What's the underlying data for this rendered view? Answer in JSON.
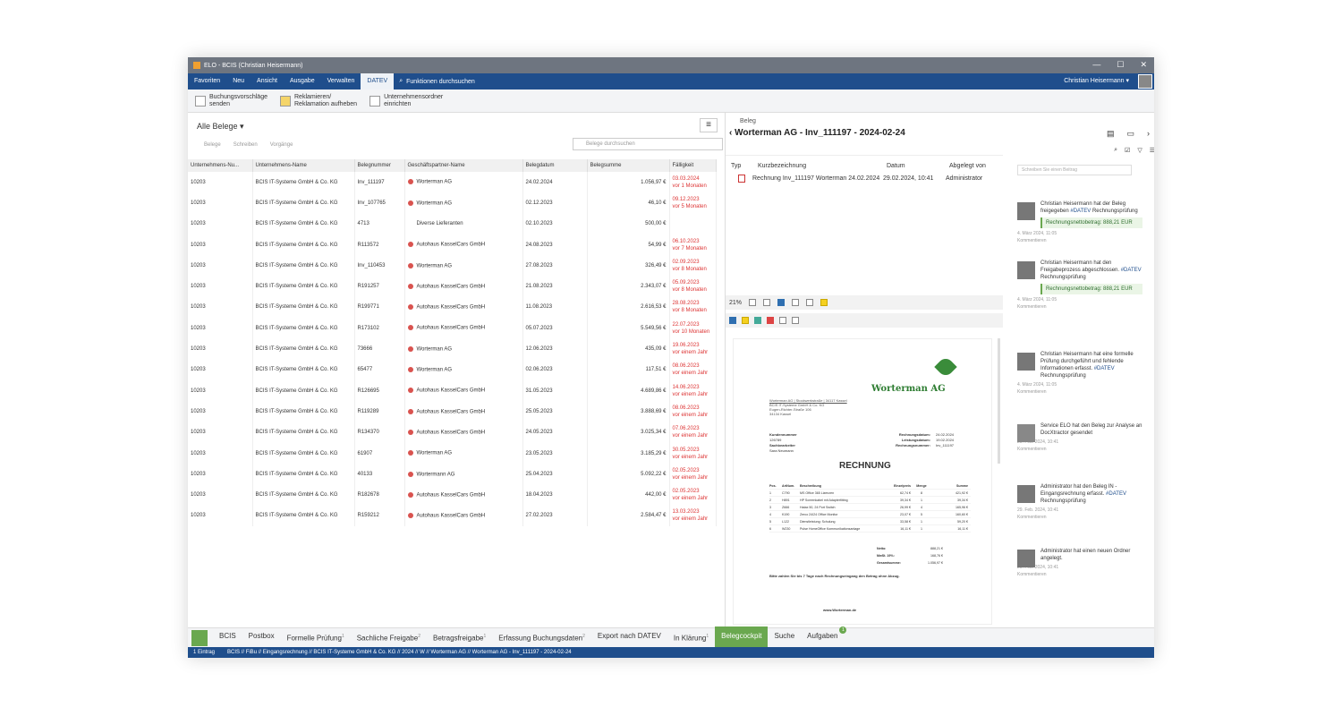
{
  "window": {
    "title": "ELO - BCIS (Christian Heisermann)",
    "controls": [
      "—",
      "☐",
      "✕"
    ]
  },
  "menu": {
    "items": [
      "Favoriten",
      "Neu",
      "Ansicht",
      "Ausgabe",
      "Verwalten",
      "DATEV"
    ],
    "active": "DATEV",
    "search": "Funktionen durchsuchen",
    "user": "Christian Heisermann"
  },
  "ribbon": [
    {
      "line1": "Buchungsvorschläge",
      "line2": "senden"
    },
    {
      "line1": "Reklamieren/",
      "line2": "Reklamation aufheben"
    },
    {
      "line1": "Unternehmensordner",
      "line2": "einrichten"
    }
  ],
  "list": {
    "title": "Alle Belege",
    "filters": [
      "Belege",
      "Schreiben",
      "Vorgänge"
    ],
    "search_placeholder": "Belege durchsuchen",
    "columns": [
      "Unternehmens-Nu...",
      "Unternehmens-Name",
      "Belegnummer",
      "Geschäftspartner-Name",
      "Belegdatum",
      "Belegsumme",
      "Fälligkeit"
    ],
    "rows": [
      {
        "nr": "10203",
        "name": "BCIS IT-Systeme GmbH & Co. KG",
        "beleg": "Inv_111197",
        "dot": true,
        "partner": "Worterman AG",
        "datum": "24.02.2024",
        "summe": "1.056,97 €",
        "due1": "03.03.2024",
        "due2": "vor 1 Monaten"
      },
      {
        "nr": "10203",
        "name": "BCIS IT-Systeme GmbH & Co. KG",
        "beleg": "Inv_107765",
        "dot": true,
        "partner": "Worterman AG",
        "datum": "02.12.2023",
        "summe": "46,10 €",
        "due1": "09.12.2023",
        "due2": "vor 5 Monaten"
      },
      {
        "nr": "10203",
        "name": "BCIS IT-Systeme GmbH & Co. KG",
        "beleg": "4713",
        "dot": false,
        "partner": "Diverse Lieferanten",
        "datum": "02.10.2023",
        "summe": "500,00 €",
        "due1": "",
        "due2": ""
      },
      {
        "nr": "10203",
        "name": "BCIS IT-Systeme GmbH & Co. KG",
        "beleg": "R113572",
        "dot": true,
        "partner": "Autohaus KasselCars GmbH",
        "datum": "24.08.2023",
        "summe": "54,99 €",
        "due1": "06.10.2023",
        "due2": "vor 7 Monaten"
      },
      {
        "nr": "10203",
        "name": "BCIS IT-Systeme GmbH & Co. KG",
        "beleg": "Inv_110453",
        "dot": true,
        "partner": "Worterman AG",
        "datum": "27.08.2023",
        "summe": "326,49 €",
        "due1": "02.09.2023",
        "due2": "vor 8 Monaten"
      },
      {
        "nr": "10203",
        "name": "BCIS IT-Systeme GmbH & Co. KG",
        "beleg": "R191257",
        "dot": true,
        "partner": "Autohaus KasselCars GmbH",
        "datum": "21.08.2023",
        "summe": "2.343,07 €",
        "due1": "05.09.2023",
        "due2": "vor 8 Monaten"
      },
      {
        "nr": "10203",
        "name": "BCIS IT-Systeme GmbH & Co. KG",
        "beleg": "R199771",
        "dot": true,
        "partner": "Autohaus KasselCars GmbH",
        "datum": "11.08.2023",
        "summe": "2.616,53 €",
        "due1": "28.08.2023",
        "due2": "vor 8 Monaten"
      },
      {
        "nr": "10203",
        "name": "BCIS IT-Systeme GmbH & Co. KG",
        "beleg": "R173102",
        "dot": true,
        "partner": "Autohaus KasselCars GmbH",
        "datum": "05.07.2023",
        "summe": "5.549,56 €",
        "due1": "22.07.2023",
        "due2": "vor 10 Monaten"
      },
      {
        "nr": "10203",
        "name": "BCIS IT-Systeme GmbH & Co. KG",
        "beleg": "73666",
        "dot": true,
        "partner": "Worterman AG",
        "datum": "12.06.2023",
        "summe": "435,09 €",
        "due1": "19.06.2023",
        "due2": "vor einem Jahr"
      },
      {
        "nr": "10203",
        "name": "BCIS IT-Systeme GmbH & Co. KG",
        "beleg": "65477",
        "dot": true,
        "partner": "Worterman AG",
        "datum": "02.06.2023",
        "summe": "117,51 €",
        "due1": "08.06.2023",
        "due2": "vor einem Jahr"
      },
      {
        "nr": "10203",
        "name": "BCIS IT-Systeme GmbH & Co. KG",
        "beleg": "R126695",
        "dot": true,
        "partner": "Autohaus KasselCars GmbH",
        "datum": "31.05.2023",
        "summe": "4.689,86 €",
        "due1": "14.06.2023",
        "due2": "vor einem Jahr"
      },
      {
        "nr": "10203",
        "name": "BCIS IT-Systeme GmbH & Co. KG",
        "beleg": "R119289",
        "dot": true,
        "partner": "Autohaus KasselCars GmbH",
        "datum": "25.05.2023",
        "summe": "3.888,69 €",
        "due1": "08.06.2023",
        "due2": "vor einem Jahr"
      },
      {
        "nr": "10203",
        "name": "BCIS IT-Systeme GmbH & Co. KG",
        "beleg": "R134370",
        "dot": true,
        "partner": "Autohaus KasselCars GmbH",
        "datum": "24.05.2023",
        "summe": "3.025,34 €",
        "due1": "07.06.2023",
        "due2": "vor einem Jahr"
      },
      {
        "nr": "10203",
        "name": "BCIS IT-Systeme GmbH & Co. KG",
        "beleg": "61907",
        "dot": true,
        "partner": "Worterman AG",
        "datum": "23.05.2023",
        "summe": "3.185,29 €",
        "due1": "30.05.2023",
        "due2": "vor einem Jahr"
      },
      {
        "nr": "10203",
        "name": "BCIS IT-Systeme GmbH & Co. KG",
        "beleg": "40133",
        "dot": true,
        "partner": "Wortermann AG",
        "datum": "25.04.2023",
        "summe": "5.092,22 €",
        "due1": "02.05.2023",
        "due2": "vor einem Jahr"
      },
      {
        "nr": "10203",
        "name": "BCIS IT-Systeme GmbH & Co. KG",
        "beleg": "R182678",
        "dot": true,
        "partner": "Autohaus KasselCars GmbH",
        "datum": "18.04.2023",
        "summe": "442,00 €",
        "due1": "02.05.2023",
        "due2": "vor einem Jahr"
      },
      {
        "nr": "10203",
        "name": "BCIS IT-Systeme GmbH & Co. KG",
        "beleg": "R159212",
        "dot": true,
        "partner": "Autohaus KasselCars GmbH",
        "datum": "27.02.2023",
        "summe": "2.584,47 €",
        "due1": "13.03.2023",
        "due2": "vor einem Jahr"
      }
    ]
  },
  "detail": {
    "label": "Beleg",
    "title": "Worterman AG - Inv_111197 - 2024-02-24",
    "headers": [
      "Typ",
      "Kurzbezeichnung",
      "Datum",
      "Abgelegt von"
    ],
    "row": {
      "kurz": "Rechnung Inv_111197 Worterman 24.02.2024",
      "datum": "29.02.2024, 10:41",
      "von": "Administrator"
    },
    "zoom": "21%"
  },
  "invoice": {
    "company": "Worterman AG",
    "sender": [
      "Worterman AG | Stockwerkstraße | 34117 Kassel",
      "BCIS IT-Systeme GmbH & Co. KG",
      "Eugen-Richter-Straße 106",
      "34134 Kassel"
    ],
    "meta_left": [
      "Kundennummer",
      "126789",
      "Sachbearbeiter",
      "Sara Neumann"
    ],
    "meta_right_labels": [
      "Rechnungsdatum:",
      "Leistungsdatum:",
      "Rechnungsnummer:"
    ],
    "meta_right_values": [
      "24.02.2024",
      "19.02.2024",
      "Inv_111197"
    ],
    "heading": "RECHNUNG",
    "item_headers": [
      "Pos.",
      "ArtNum.",
      "Beschreibung",
      "Einzelpreis",
      "Menge",
      "Summe"
    ],
    "items": [
      [
        "1",
        "C790",
        "MS Office 365 Lizenzen",
        "62,74 €",
        "8",
        "421,92 €"
      ],
      [
        "2",
        "H891",
        "HP Screenkabel mit Adapterfitting",
        "39,34 €",
        "1",
        "39,34 €"
      ],
      [
        "3",
        "Z666",
        "Hatax 50, 24 Port Switch",
        "26,99 €",
        "4",
        "165,96 €"
      ],
      [
        "4",
        "K190",
        "Zerco 24/24 Office Monitor",
        "23,07 €",
        "5",
        "160,60 €"
      ],
      [
        "5",
        "L122",
        "Dienstleistung: Schulung",
        "33,58 €",
        "1",
        "59,20 €"
      ],
      [
        "6",
        "W230",
        "Pulse HomeOffice Kommunikationsanlage",
        "16,11 €",
        "1",
        "16,11 €"
      ]
    ],
    "totals": [
      [
        "Netto:",
        "888,21 €"
      ],
      [
        "MwSt. 19%:",
        "168,76 €"
      ],
      [
        "Gesamtsumme:",
        "1.056,97 €"
      ]
    ],
    "note": "Bitte zahlen Sie bis 7 Tage nach Rechnungseingang den Betrag ohne Abzug.",
    "footer": "www.Worterman.de"
  },
  "feed": {
    "comment_placeholder": "Schreiben Sie einen Beitrag",
    "entries": [
      {
        "text": "Christian Heisermann hat der Beleg freigegeben ",
        "tag": "#DATEV",
        "tail": " Rechnungsprüfung",
        "amount": "Rechnungsnettobetrag: 888,21 EUR",
        "time": "4. März 2024, 11:05",
        "comment": "Kommentieren"
      },
      {
        "text": "Christian Heisermann hat den Freigabeprozess abgeschlossen. ",
        "tag": "#DATEV",
        "tail": " Rechnungsprüfung",
        "amount": "Rechnungsnettobetrag: 888,21 EUR",
        "time": "4. März 2024, 11:05",
        "comment": "Kommentieren"
      },
      {
        "text": "Christian Heisermann hat eine formelle Prüfung durchgeführt und fehlende Informationen erfasst. ",
        "tag": "#DATEV",
        "tail": " Rechnungsprüfung",
        "amount": "",
        "time": "4. März 2024, 11:05",
        "comment": "Kommentieren"
      },
      {
        "text": "Service ELO hat den Beleg zur Analyse an DocXtractor gesendet",
        "tag": "",
        "tail": "",
        "amount": "",
        "time": "29. Feb. 2024, 10:41",
        "comment": "Kommentieren"
      },
      {
        "text": "Administrator hat den Beleg IN - Eingangsrechnung erfasst. ",
        "tag": "#DATEV",
        "tail": " Rechnungsprüfung",
        "amount": "",
        "time": "29. Feb. 2024, 10:41",
        "comment": "Kommentieren"
      },
      {
        "text": "Administrator hat einen neuen Ordner angelegt.",
        "tag": "",
        "tail": "",
        "amount": "",
        "time": "29. Feb. 2024, 10:41",
        "comment": "Kommentieren"
      }
    ]
  },
  "tabs": [
    {
      "label": "BCIS",
      "sup": ""
    },
    {
      "label": "Postbox",
      "sup": ""
    },
    {
      "label": "Formelle Prüfung",
      "sup": "1"
    },
    {
      "label": "Sachliche Freigabe",
      "sup": "2"
    },
    {
      "label": "Betragsfreigabe",
      "sup": "1"
    },
    {
      "label": "Erfassung Buchungsdaten",
      "sup": "2"
    },
    {
      "label": "Export nach DATEV",
      "sup": ""
    },
    {
      "label": "In Klärung",
      "sup": "1"
    },
    {
      "label": "Belegcockpit",
      "sup": ""
    },
    {
      "label": "Suche",
      "sup": ""
    },
    {
      "label": "Aufgaben",
      "sup": ""
    }
  ],
  "tasks_badge": "1",
  "status": {
    "count": "1 Eintrag",
    "path": "BCIS // FiBu // Eingangsrechnung // BCIS IT-Systeme GmbH & Co. KG // 2024 // W // Worterman AG // Worterman AG - Inv_111197 - 2024-02-24"
  }
}
